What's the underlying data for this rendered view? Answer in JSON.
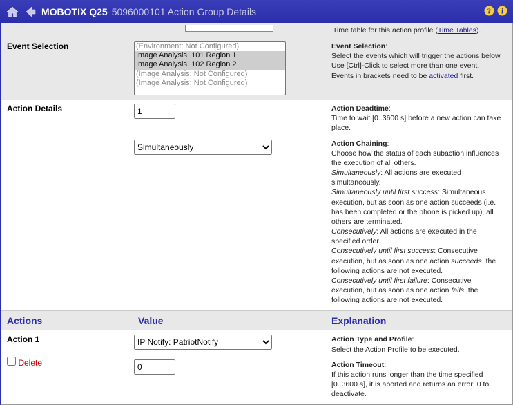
{
  "header": {
    "product": "MOBOTIX Q25",
    "sub": "5096000101 Action Group Details"
  },
  "top_note": {
    "text": "Time table for this action profile (",
    "link": "Time Tables",
    "after": ")."
  },
  "event_selection": {
    "label": "Event Selection",
    "options": [
      {
        "text": "(Environment: Not Configured)",
        "dim": true,
        "selected": false
      },
      {
        "text": "Image Analysis: 101 Region 1",
        "dim": false,
        "selected": true
      },
      {
        "text": "Image Analysis: 102 Region 2",
        "dim": false,
        "selected": true
      },
      {
        "text": "(Image Analysis: Not Configured)",
        "dim": true,
        "selected": false
      },
      {
        "text": "(Image Analysis: Not Configured)",
        "dim": true,
        "selected": false
      }
    ],
    "help": {
      "title": "Event Selection",
      "line1": "Select the events which will trigger the actions below.",
      "line2": "Use [Ctrl]-Click to select more than one event.",
      "line3_pre": "Events in brackets need to be ",
      "line3_link": "activated",
      "line3_post": " first."
    }
  },
  "action_details": {
    "label": "Action Details",
    "deadtime_value": "1",
    "chaining_value": "Simultaneously",
    "help": {
      "deadtime_title": "Action Deadtime",
      "deadtime_text": "Time to wait [0..3600 s] before a new action can take place.",
      "chaining_title": "Action Chaining",
      "chaining_intro": "Choose how the status of each subaction influences the execution of all others.",
      "sim_term": "Simultaneously",
      "sim_desc": ": All actions are executed simultaneously.",
      "simfs_term": "Simultaneously until first success",
      "simfs_desc": ": Simultaneous execution, but as soon as one action succeeds (i.e. has been completed or the phone is picked up), all others are terminated.",
      "cons_term": "Consecutively",
      "cons_desc": ": All actions are executed in the specified order.",
      "consfs_term": "Consecutively until first success",
      "consfs_desc_pre": ": Consecutive execution, but as soon as one action ",
      "consfs_desc_em": "succeeds",
      "consfs_desc_post": ", the following actions are not executed.",
      "consff_term": "Consecutively until first failure",
      "consff_desc_pre": ": Consecutive execution, but as soon as one action ",
      "consff_desc_em": "fails",
      "consff_desc_post": ", the following actions are not executed."
    }
  },
  "section_headers": {
    "actions": "Actions",
    "value": "Value",
    "explanation": "Explanation"
  },
  "action1": {
    "label": "Action 1",
    "profile_value": "IP Notify: PatriotNotify",
    "delete_label": "Delete",
    "timeout_value": "0",
    "help": {
      "type_title": "Action Type and Profile",
      "type_text": "Select the Action Profile to be executed.",
      "timeout_title": "Action Timeout",
      "timeout_text": "If this action runs longer than the time specified [0..3600 s], it is aborted and returns an error; 0 to deactivate."
    }
  }
}
